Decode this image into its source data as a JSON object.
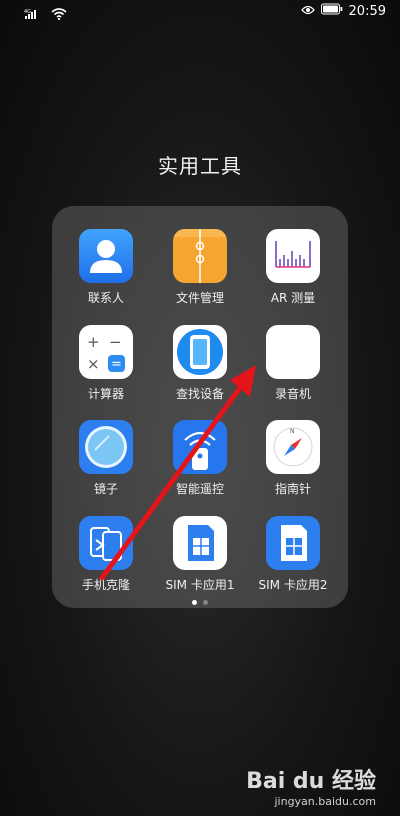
{
  "status_bar": {
    "signal_label": "4G",
    "time": "20:59"
  },
  "folder": {
    "title": "实用工具",
    "apps": [
      {
        "label": "联系人",
        "icon": "contacts-icon"
      },
      {
        "label": "文件管理",
        "icon": "file-manager-icon"
      },
      {
        "label": "AR 测量",
        "icon": "ar-measure-icon"
      },
      {
        "label": "计算器",
        "icon": "calculator-icon"
      },
      {
        "label": "查找设备",
        "icon": "find-device-icon"
      },
      {
        "label": "录音机",
        "icon": "recorder-icon"
      },
      {
        "label": "镜子",
        "icon": "mirror-icon"
      },
      {
        "label": "智能遥控",
        "icon": "smart-remote-icon"
      },
      {
        "label": "指南针",
        "icon": "compass-icon"
      },
      {
        "label": "手机克隆",
        "icon": "phone-clone-icon"
      },
      {
        "label": "SIM 卡应用1",
        "icon": "sim-card-icon"
      },
      {
        "label": "SIM 卡应用2",
        "icon": "sim-card-icon"
      }
    ],
    "page_count": 2,
    "active_page": 1
  },
  "watermark": {
    "logo": "Bai du 经验",
    "url": "jingyan.baidu.com"
  },
  "colors": {
    "blue": "#2d7ff0",
    "orange": "#f6a531",
    "red_arrow": "#e5141a"
  }
}
